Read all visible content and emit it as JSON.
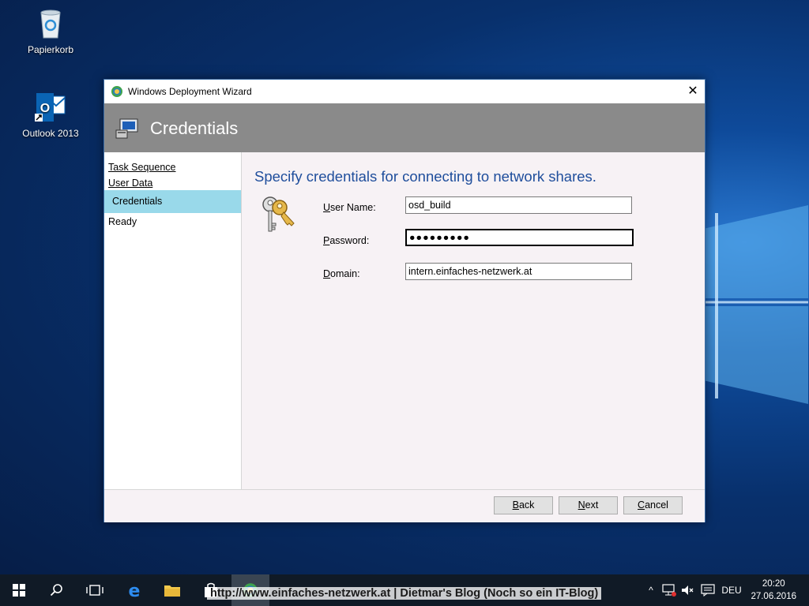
{
  "desktop": {
    "icons": [
      {
        "label": "Papierkorb",
        "icon": "recycle-bin-icon"
      },
      {
        "label": "Outlook 2013",
        "icon": "outlook-icon"
      }
    ]
  },
  "window": {
    "title": "Windows Deployment Wizard",
    "banner_title": "Credentials"
  },
  "sidebar": {
    "items": [
      {
        "label": "Task Sequence"
      },
      {
        "label": "User Data"
      },
      {
        "label": "Credentials"
      },
      {
        "label": "Ready"
      }
    ]
  },
  "main": {
    "heading": "Specify credentials for connecting to network shares.",
    "fields": {
      "username_label_u": "U",
      "username_label_rest": "ser Name:",
      "username_value": "osd_build",
      "password_label_u": "P",
      "password_label_rest": "assword:",
      "password_value": "●●●●●●●●●",
      "domain_label_u": "D",
      "domain_label_rest": "omain:",
      "domain_value": "intern.einfaches-netzwerk.at"
    }
  },
  "footer": {
    "back_u": "B",
    "back_rest": "ack",
    "next_u": "N",
    "next_rest": "ext",
    "cancel_u": "C",
    "cancel_rest": "ancel"
  },
  "taskbar": {
    "language": "DEU",
    "time": "20:20",
    "date": "27.06.2016"
  },
  "watermark": "http://www.einfaches-netzwerk.at | Dietmar's Blog (Noch so ein IT-Blog)",
  "colors": {
    "banner": "#8a8a8a",
    "selection": "#99d9ea",
    "heading": "#1f4e9c",
    "taskbar": "#101a26"
  }
}
